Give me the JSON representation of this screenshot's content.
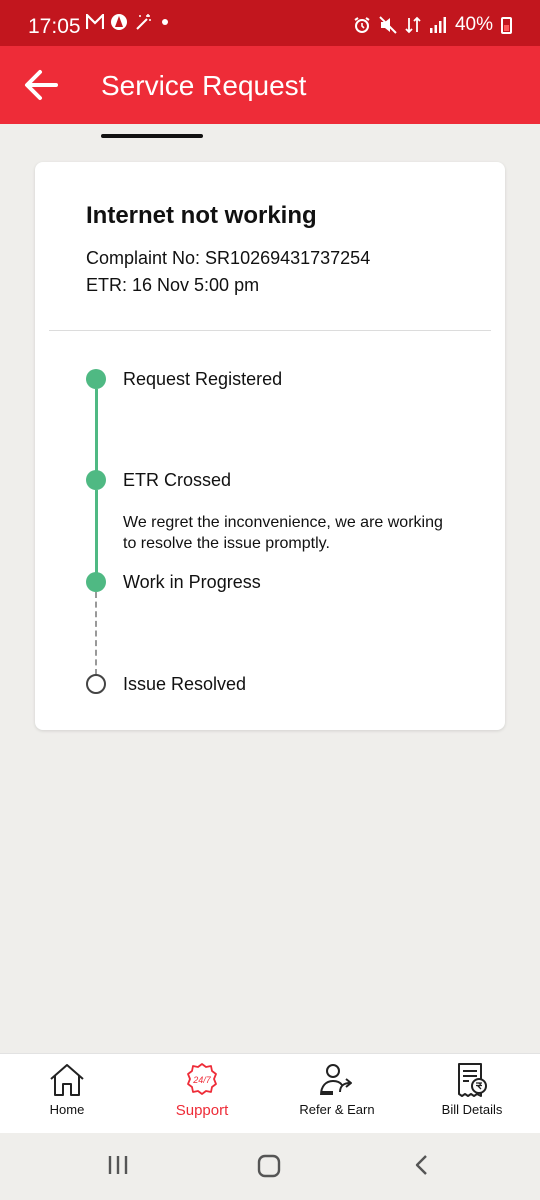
{
  "status_bar": {
    "time": "17:05",
    "battery": "40%"
  },
  "app_bar": {
    "title": "Service Request"
  },
  "card": {
    "title": "Internet not working",
    "complaint_no": "Complaint No: SR10269431737254",
    "etr": "ETR: 16 Nov 5:00 pm"
  },
  "timeline": [
    {
      "label": "Request Registered",
      "status": "done"
    },
    {
      "label": "ETR Crossed",
      "status": "done",
      "description": "We regret the inconvenience, we are working to resolve the issue promptly."
    },
    {
      "label": "Work in Progress",
      "status": "done"
    },
    {
      "label": "Issue Resolved",
      "status": "pending"
    }
  ],
  "bottom_nav": [
    {
      "label": "Home",
      "icon": "home-icon"
    },
    {
      "label": "Support",
      "icon": "support-247-icon",
      "active": true,
      "badge": "24/7"
    },
    {
      "label": "Refer & Earn",
      "icon": "refer-icon"
    },
    {
      "label": "Bill Details",
      "icon": "bill-icon"
    }
  ],
  "colors": {
    "status_bar": "#c2161e",
    "app_bar": "#ee2c38",
    "timeline_done": "#4fb983"
  }
}
